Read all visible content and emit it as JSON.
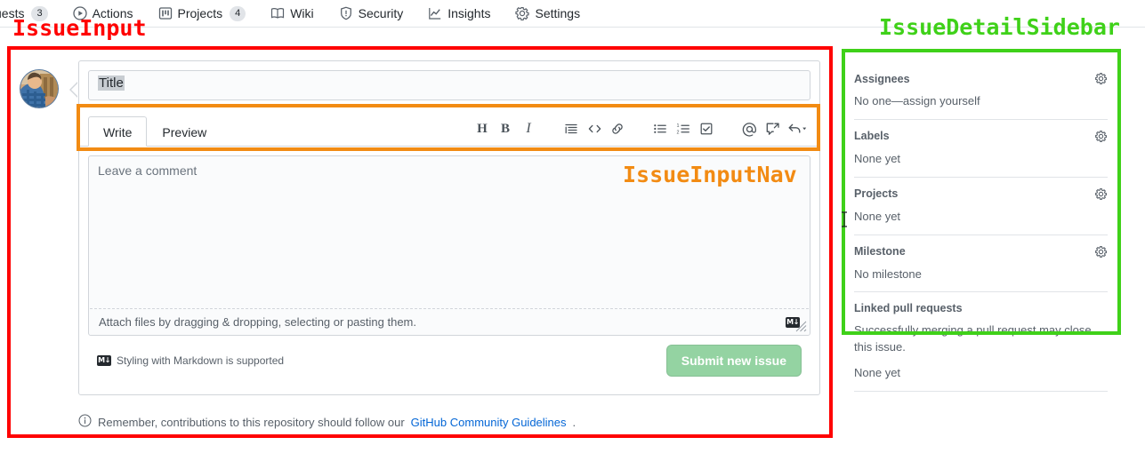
{
  "repo_nav": {
    "items": [
      {
        "id": "pull-requests",
        "label": "uests",
        "count": "3",
        "icon": "git-pull-request-icon"
      },
      {
        "id": "actions",
        "label": "Actions",
        "count": "",
        "icon": "play-circle-icon"
      },
      {
        "id": "projects",
        "label": "Projects",
        "count": "4",
        "icon": "project-board-icon"
      },
      {
        "id": "wiki",
        "label": "Wiki",
        "count": "",
        "icon": "book-icon"
      },
      {
        "id": "security",
        "label": "Security",
        "count": "",
        "icon": "shield-icon"
      },
      {
        "id": "insights",
        "label": "Insights",
        "count": "",
        "icon": "graph-icon"
      },
      {
        "id": "settings",
        "label": "Settings",
        "count": "",
        "icon": "gear-icon"
      }
    ]
  },
  "annotations": {
    "issue_input": {
      "label": "IssueInput",
      "color": "#ff0000"
    },
    "issue_input_nav": {
      "label": "IssueInputNav",
      "color": "#f28b13"
    },
    "issue_detail_sidebar": {
      "label": "IssueDetailSidebar",
      "color": "#3fd119"
    }
  },
  "issue_form": {
    "title_field": {
      "value": "Title",
      "placeholder": "Title"
    },
    "tabs": [
      {
        "id": "write",
        "label": "Write",
        "selected": true
      },
      {
        "id": "preview",
        "label": "Preview",
        "selected": false
      }
    ],
    "toolbar": [
      {
        "id": "heading",
        "name": "heading-icon",
        "glyph": "H"
      },
      {
        "id": "bold",
        "name": "bold-icon",
        "glyph": "B"
      },
      {
        "id": "italic",
        "name": "italic-icon",
        "glyph": "I"
      },
      {
        "id": "quote",
        "name": "quote-icon",
        "glyph": ""
      },
      {
        "id": "code",
        "name": "code-icon",
        "glyph": "<>"
      },
      {
        "id": "link",
        "name": "link-icon",
        "glyph": ""
      },
      {
        "id": "unordered-list",
        "name": "unordered-list-icon",
        "glyph": ""
      },
      {
        "id": "ordered-list",
        "name": "ordered-list-icon",
        "glyph": ""
      },
      {
        "id": "task-list",
        "name": "task-list-icon",
        "glyph": ""
      },
      {
        "id": "mention",
        "name": "mention-icon",
        "glyph": "@"
      },
      {
        "id": "reference",
        "name": "cross-reference-icon",
        "glyph": ""
      },
      {
        "id": "saved-replies",
        "name": "reply-icon",
        "glyph": ""
      }
    ],
    "comment": {
      "placeholder": "Leave a comment",
      "value": ""
    },
    "dropzone_text": "Attach files by dragging & dropping, selecting or pasting them.",
    "markdown_badge": "M↓",
    "markdown_support_text": "Styling with Markdown is supported",
    "submit_button": {
      "label": "Submit new issue",
      "color": "#94d3a2",
      "disabled": true
    },
    "community_note": {
      "prefix": "Remember, contributions to this repository should follow our ",
      "link": "GitHub Community Guidelines",
      "suffix": "."
    }
  },
  "sidebar": {
    "sections": [
      {
        "id": "assignees",
        "title": "Assignees",
        "value": "No one—assign yourself",
        "gear": "gear-icon"
      },
      {
        "id": "labels",
        "title": "Labels",
        "value": "None yet",
        "gear": "gear-icon"
      },
      {
        "id": "projects",
        "title": "Projects",
        "value": "None yet",
        "gear": "gear-icon"
      },
      {
        "id": "milestone",
        "title": "Milestone",
        "value": "No milestone",
        "gear": "gear-icon"
      }
    ],
    "linked_pull_requests": {
      "title": "Linked pull requests",
      "description": "Successfully merging a pull request may close this issue.",
      "value": "None yet"
    }
  }
}
